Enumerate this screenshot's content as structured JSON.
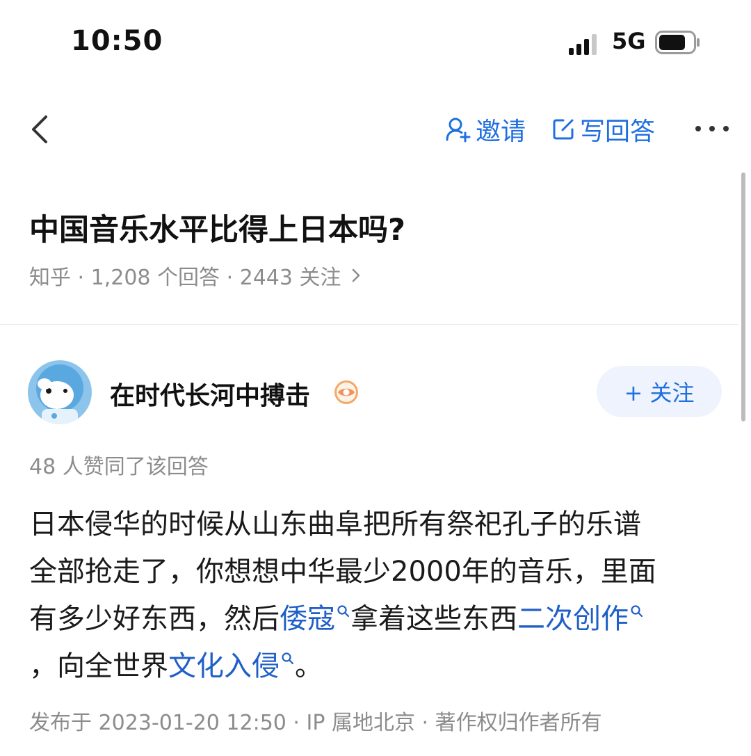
{
  "status_bar": {
    "time": "10:50",
    "network": "5G"
  },
  "nav": {
    "invite_label": "邀请",
    "write_label": "写回答"
  },
  "question": {
    "title": "中国音乐水平比得上日本吗?",
    "meta": "知乎 · 1,208 个回答 · 2443 关注"
  },
  "author": {
    "name": "在时代长河中搏击",
    "follow_label": "+ 关注"
  },
  "likes_text": "48 人赞同了该回答",
  "answer": {
    "line1": "日本侵华的时候从山东曲阜把所有祭祀孔子的乐谱",
    "line2": "全部抢走了，你想想中华最少2000年的音乐，里面",
    "line3_pre": "有多少好东西，然后",
    "kw1": "倭寇",
    "line3_mid": "拿着这些东西",
    "kw2": "二次创作",
    "line4_pre": "，向全世界",
    "kw3": "文化入侵",
    "line4_post": "。"
  },
  "footer": "发布于 2023-01-20 12:50 · IP 属地北京 · 著作权归作者所有",
  "colors": {
    "accent": "#1f6fe0",
    "link": "#1f5fc7",
    "muted": "#8c8c8c",
    "follow_bg": "#eef3fd"
  }
}
